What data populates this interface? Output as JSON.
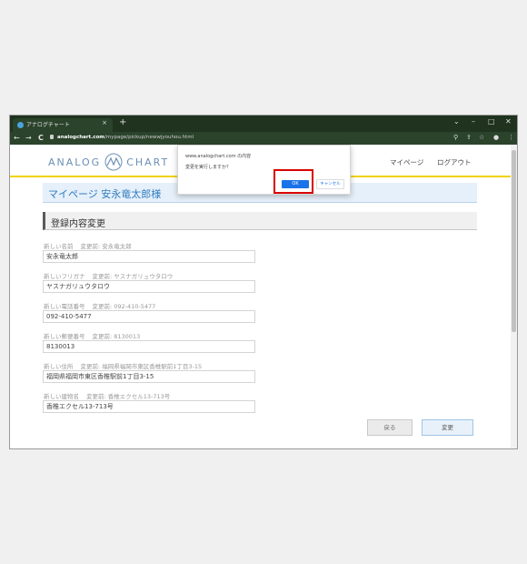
{
  "browser": {
    "tab_title": "アナログチャート",
    "tab_close": "×",
    "new_tab": "+",
    "window_controls": [
      "⌄",
      "–",
      "□",
      "✕"
    ],
    "nav": [
      "←",
      "→",
      "C"
    ],
    "url_host": "analogchart.com",
    "url_path": "/mypage/pickup/newwjyouhou.html",
    "toolbar_icons": [
      "⚲",
      "⇪",
      "☆",
      "●",
      "⋮"
    ]
  },
  "site": {
    "logo_left": "ANALOG",
    "logo_right": "CHART",
    "nav": [
      "マイページ",
      "ログアウト"
    ]
  },
  "main": {
    "page_title": "マイページ 安永竜太郎様",
    "section_title": "登録内容変更",
    "fields": [
      {
        "label": "新しい名前",
        "prev": "変更前: 安永竜太郎",
        "value": "安永竜太郎"
      },
      {
        "label": "新しいフリガナ",
        "prev": "変更前: ヤスナガリュウタロウ",
        "value": "ヤスナガリュウタロウ"
      },
      {
        "label": "新しい電話番号",
        "prev": "変更前: 092-410-5477",
        "value": "092-410-5477"
      },
      {
        "label": "新しい郵便番号",
        "prev": "変更前: 8130013",
        "value": "8130013"
      },
      {
        "label": "新しい住所",
        "prev": "変更前: 福岡県福岡市東区香椎駅前1丁目3-15",
        "value": "福岡県福岡市東区香椎駅前1丁目3-15"
      },
      {
        "label": "新しい建物名",
        "prev": "変更前: 香椎エクセル13-713号",
        "value": "香椎エクセル13-713号"
      }
    ],
    "back_label": "戻る",
    "change_label": "変更"
  },
  "dialog": {
    "origin": "www.analogchart.com の内容",
    "message": "変更を実行しますか？",
    "ok_label": "OK",
    "cancel_label": "キャンセル"
  },
  "colors": {
    "highlight": "#d90000",
    "ok_button": "#1a73e8",
    "header_line": "#f0d200"
  }
}
